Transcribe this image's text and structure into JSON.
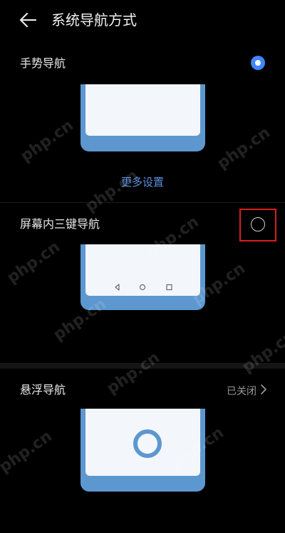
{
  "header": {
    "title": "系统导航方式",
    "back_icon": "arrow-left-icon"
  },
  "options": [
    {
      "label": "手势导航",
      "selected": true
    },
    {
      "label": "屏幕内三键导航",
      "selected": false
    },
    {
      "label": "悬浮导航",
      "status": "已关闭"
    }
  ],
  "gesture_more_link": "更多设置",
  "watermark": "php.cn",
  "colors": {
    "background": "#000000",
    "accent": "#3f86ff",
    "link": "#5b8fe0",
    "preview_frame": "#5d97d0",
    "preview_screen": "#f3f7fb",
    "highlight": "#d81e1e"
  }
}
